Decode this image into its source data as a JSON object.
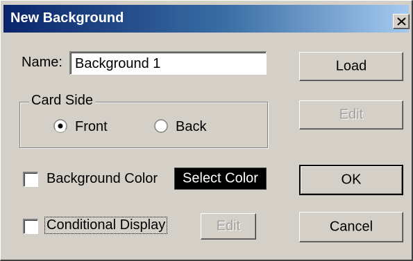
{
  "window": {
    "title": "New Background"
  },
  "name_field": {
    "label": "Name:",
    "value": "Background 1"
  },
  "card_side": {
    "group_label": "Card Side",
    "options": [
      {
        "label": "Front",
        "selected": true
      },
      {
        "label": "Back",
        "selected": false
      }
    ]
  },
  "background_color": {
    "label": "Background Color",
    "checked": false,
    "select_button_label": "Select Color"
  },
  "conditional_display": {
    "label": "Conditional Display",
    "checked": false,
    "edit_label": "Edit"
  },
  "buttons": {
    "load": "Load",
    "edit": "Edit",
    "ok": "OK",
    "cancel": "Cancel"
  },
  "icons": {
    "close": "close-icon",
    "radio_selected": "radio-selected-icon",
    "radio_unselected": "radio-unselected-icon"
  },
  "colors": {
    "title_bar_start": "#0a246a",
    "title_bar_end": "#a6caf0",
    "dialog_background": "#d4d0c8",
    "select_color_swatch": "#000000"
  }
}
